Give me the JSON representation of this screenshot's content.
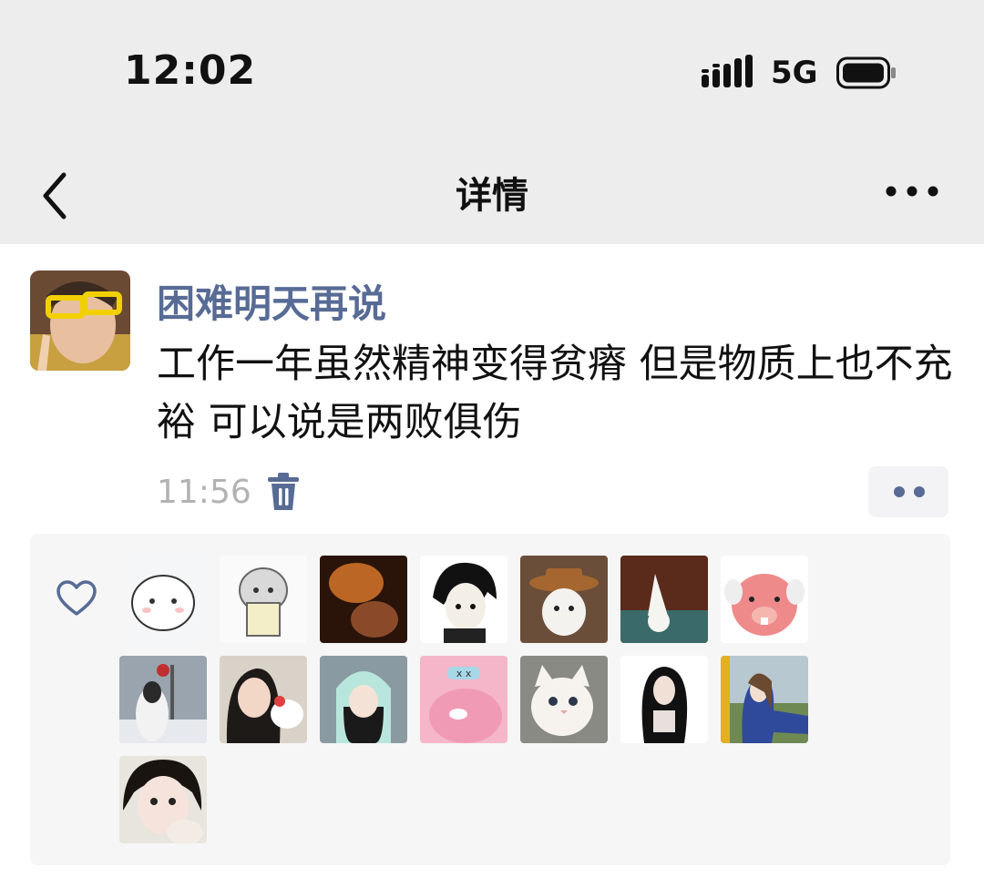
{
  "status_bar": {
    "time": "12:02",
    "network": "5G"
  },
  "nav": {
    "title": "详情",
    "back_icon": "chevron-left-icon",
    "more_icon": "more-dots-icon"
  },
  "post": {
    "username": "困难明天再说",
    "text": "工作一年虽然精神变得贫瘠 但是物质上也不充裕 可以说是两败俱伤",
    "time": "11:56"
  },
  "likes": {
    "icon": "heart-icon",
    "count": 15
  },
  "colors": {
    "username": "#576b95",
    "bar_bg": "#ededed",
    "panel_bg": "#f6f6f6",
    "time": "#b2b2b2"
  }
}
